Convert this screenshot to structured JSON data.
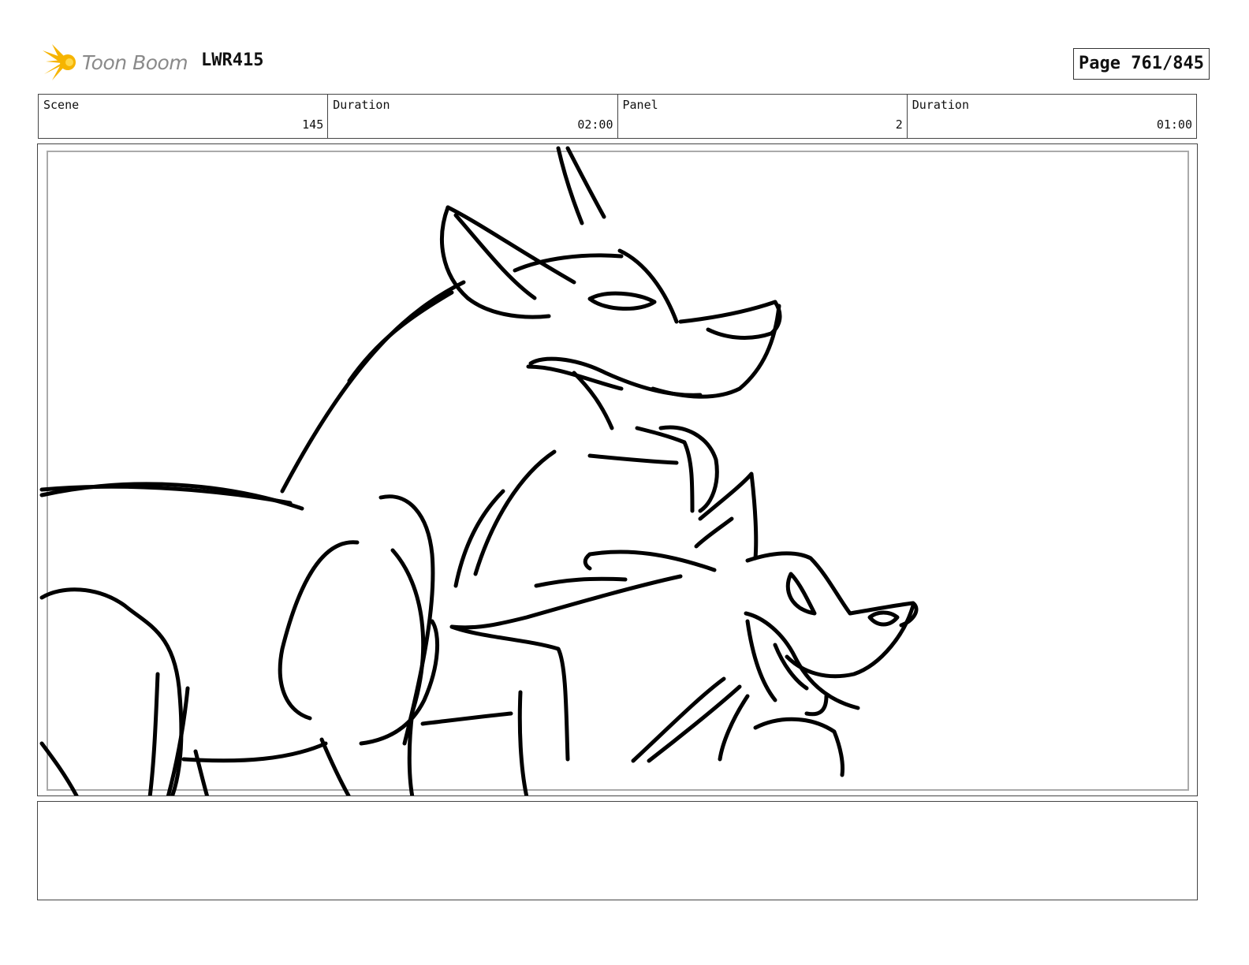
{
  "header": {
    "logo_text": "Toon Boom",
    "project": "LWR415",
    "page": "Page 761/845"
  },
  "info": [
    {
      "label": "Scene",
      "value": "145"
    },
    {
      "label": "Duration",
      "value": "02:00"
    },
    {
      "label": "Panel",
      "value": "2"
    },
    {
      "label": "Duration",
      "value": "01:00"
    }
  ],
  "notes": {
    "text": ""
  },
  "colors": {
    "logo_accent": "#f6b400",
    "logo_text": "#8a8a8a",
    "border": "#444444"
  },
  "icons": {
    "logo": "starburst-icon"
  }
}
